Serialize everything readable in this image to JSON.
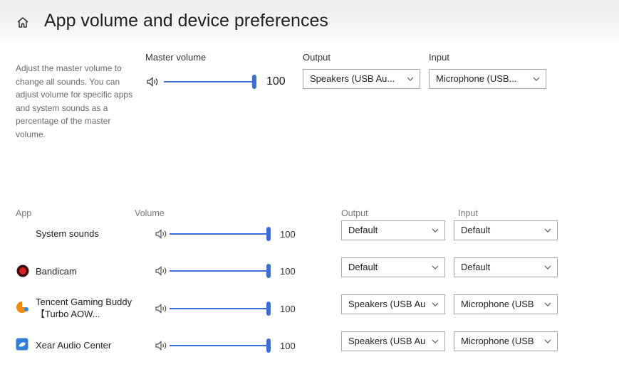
{
  "header": {
    "title": "App volume and device preferences",
    "icon": "home-icon"
  },
  "master": {
    "description": "Adjust the master volume to change all sounds. You can adjust volume for specific apps and system sounds as a percentage of the master volume.",
    "volume_label": "Master volume",
    "volume_value": "100",
    "volume_level": 100,
    "output_label": "Output",
    "output_value": "Speakers (USB Au...",
    "input_label": "Input",
    "input_value": "Microphone (USB..."
  },
  "apps_header": {
    "app": "App",
    "volume": "Volume",
    "output": "Output",
    "input": "Input"
  },
  "apps": [
    {
      "name": "System sounds",
      "volume": "100",
      "volume_level": 100,
      "output": "Default",
      "input": "Default",
      "icon": "none"
    },
    {
      "name": "Bandicam",
      "volume": "100",
      "volume_level": 100,
      "output": "Default",
      "input": "Default",
      "icon": "bandicam-icon"
    },
    {
      "name": "Tencent Gaming Buddy【Turbo AOW...",
      "volume": "100",
      "volume_level": 100,
      "output": "Speakers (USB Au",
      "input": "Microphone (USB",
      "icon": "tencent-gaming-buddy-icon"
    },
    {
      "name": "Xear Audio Center",
      "volume": "100",
      "volume_level": 100,
      "output": "Speakers (USB Au",
      "input": "Microphone (USB",
      "icon": "xear-audio-icon"
    }
  ],
  "colors": {
    "accent": "#3a6fd8"
  }
}
